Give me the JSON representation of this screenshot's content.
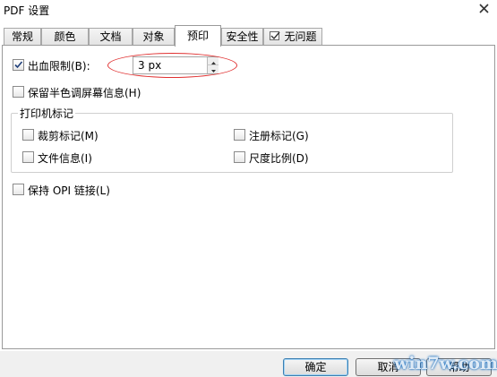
{
  "window": {
    "title": "PDF 设置"
  },
  "tabs": [
    {
      "label": "常规",
      "active": false
    },
    {
      "label": "颜色",
      "active": false
    },
    {
      "label": "文档",
      "active": false
    },
    {
      "label": "对象",
      "active": false
    },
    {
      "label": "预印",
      "active": true
    },
    {
      "label": "安全性",
      "active": false
    },
    {
      "label": "无问题",
      "active": false,
      "icon": "checkmark-page-icon"
    }
  ],
  "prepress": {
    "bleed_limit": {
      "label": "出血限制(B):",
      "checked": true,
      "value": "3 px"
    },
    "halftone_info": {
      "label": "保留半色调屏幕信息(H)",
      "checked": false
    },
    "printer_marks": {
      "title": "打印机标记",
      "crop_marks": {
        "label": "裁剪标记(M)",
        "checked": false
      },
      "registration_marks": {
        "label": "注册标记(G)",
        "checked": false
      },
      "file_info": {
        "label": "文件信息(I)",
        "checked": false
      },
      "scale": {
        "label": "尺度比例(D)",
        "checked": false
      }
    },
    "opi_links": {
      "label": "保持 OPI 链接(L)",
      "checked": false
    }
  },
  "buttons": {
    "ok": "确定",
    "cancel": "取消",
    "help": "帮助"
  },
  "watermark": "win7w.com",
  "colors": {
    "highlight_ellipse": "#e03030",
    "default_button_border": "#3c7fb1"
  }
}
